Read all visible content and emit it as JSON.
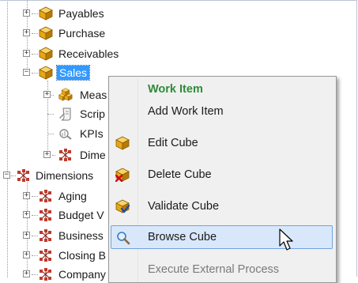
{
  "tree": {
    "cubes": [
      {
        "label": "Payables",
        "expander": "+"
      },
      {
        "label": "Purchase",
        "expander": "+"
      },
      {
        "label": "Receivables",
        "expander": "+"
      },
      {
        "label": "Sales",
        "expander": "−",
        "selected": true
      }
    ],
    "sales_children": [
      {
        "label": "Meas",
        "icon": "measures-icon",
        "expander": "+"
      },
      {
        "label": "Scrip",
        "icon": "script-icon",
        "expander": ""
      },
      {
        "label": "KPIs",
        "icon": "kpi-icon",
        "expander": ""
      },
      {
        "label": "Dime",
        "icon": "dimension-icon",
        "expander": "+"
      }
    ],
    "dimensions_folder": {
      "label": "Dimensions",
      "expander": "−"
    },
    "dimensions": [
      {
        "label": "Aging"
      },
      {
        "label": "Budget V"
      },
      {
        "label": "Business"
      },
      {
        "label": "Closing B"
      },
      {
        "label": "Company"
      }
    ]
  },
  "context_menu": {
    "header": "Work Item",
    "items": [
      {
        "label": "Add Work Item",
        "icon": ""
      },
      {
        "label": "Edit Cube",
        "icon": "cube-icon"
      },
      {
        "label": "Delete Cube",
        "icon": "delete-cube-icon"
      },
      {
        "label": "Validate Cube",
        "icon": "validate-cube-icon"
      },
      {
        "label": "Browse Cube",
        "icon": "magnifier-icon",
        "highlighted": true
      },
      {
        "label": "Execute External Process",
        "icon": "",
        "disabled": true
      }
    ]
  },
  "colors": {
    "menu_header": "#2e8b3a",
    "selection": "#3399ff",
    "menu_highlight_fill": "#d8e8fa",
    "menu_highlight_border": "#6fa3de",
    "cube_gold": "#e8a712",
    "dimension_red": "#c0392b"
  }
}
